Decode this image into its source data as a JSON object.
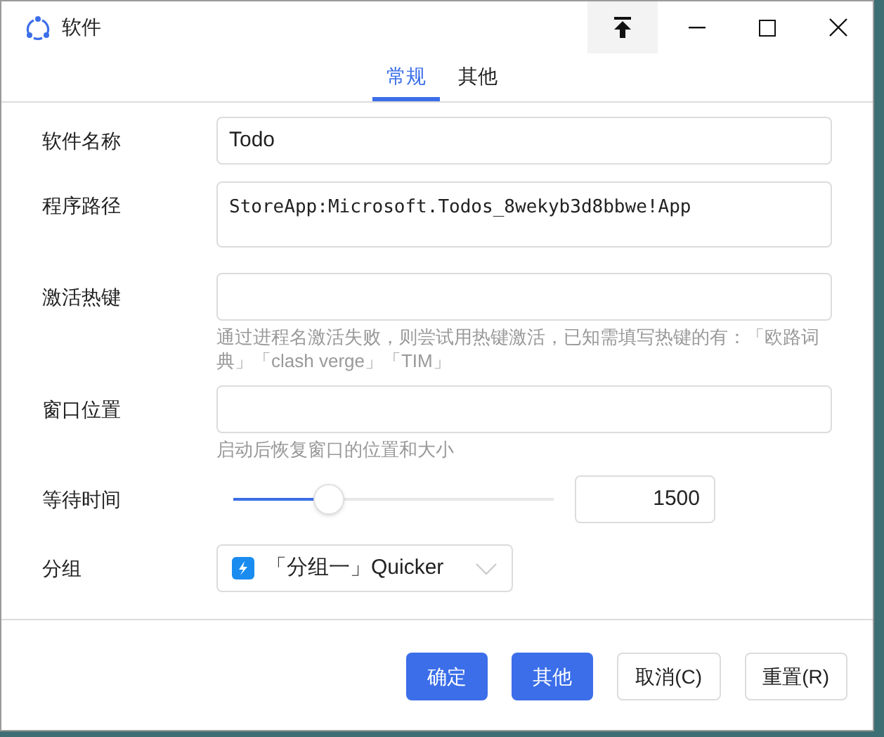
{
  "window": {
    "title": "软件"
  },
  "tabs": [
    {
      "label": "常规",
      "selected": true
    },
    {
      "label": "其他",
      "selected": false
    }
  ],
  "form": {
    "name": {
      "label": "软件名称",
      "value": "Todo"
    },
    "path": {
      "label": "程序路径",
      "value": "StoreApp:Microsoft.Todos_8wekyb3d8bbwe!App"
    },
    "hotkey": {
      "label": "激活热键",
      "hint": "通过进程名激活失败，则尝试用热键激活，已知需填写热键的有：「欧路词典」「clash verge」「TIM」"
    },
    "window_position": {
      "label": "窗口位置",
      "hint": "启动后恢复窗口的位置和大小"
    },
    "wait": {
      "label": "等待时间",
      "level": 0.3,
      "value": "1500"
    },
    "group": {
      "label": "分组",
      "value": "「分组一」Quicker"
    }
  },
  "buttons": [
    {
      "label": "确定",
      "kind": "primary"
    },
    {
      "label": "其他",
      "kind": "primary"
    },
    {
      "label": "取消(C)",
      "kind": "default"
    },
    {
      "label": "重置(R)",
      "kind": "default"
    }
  ]
}
